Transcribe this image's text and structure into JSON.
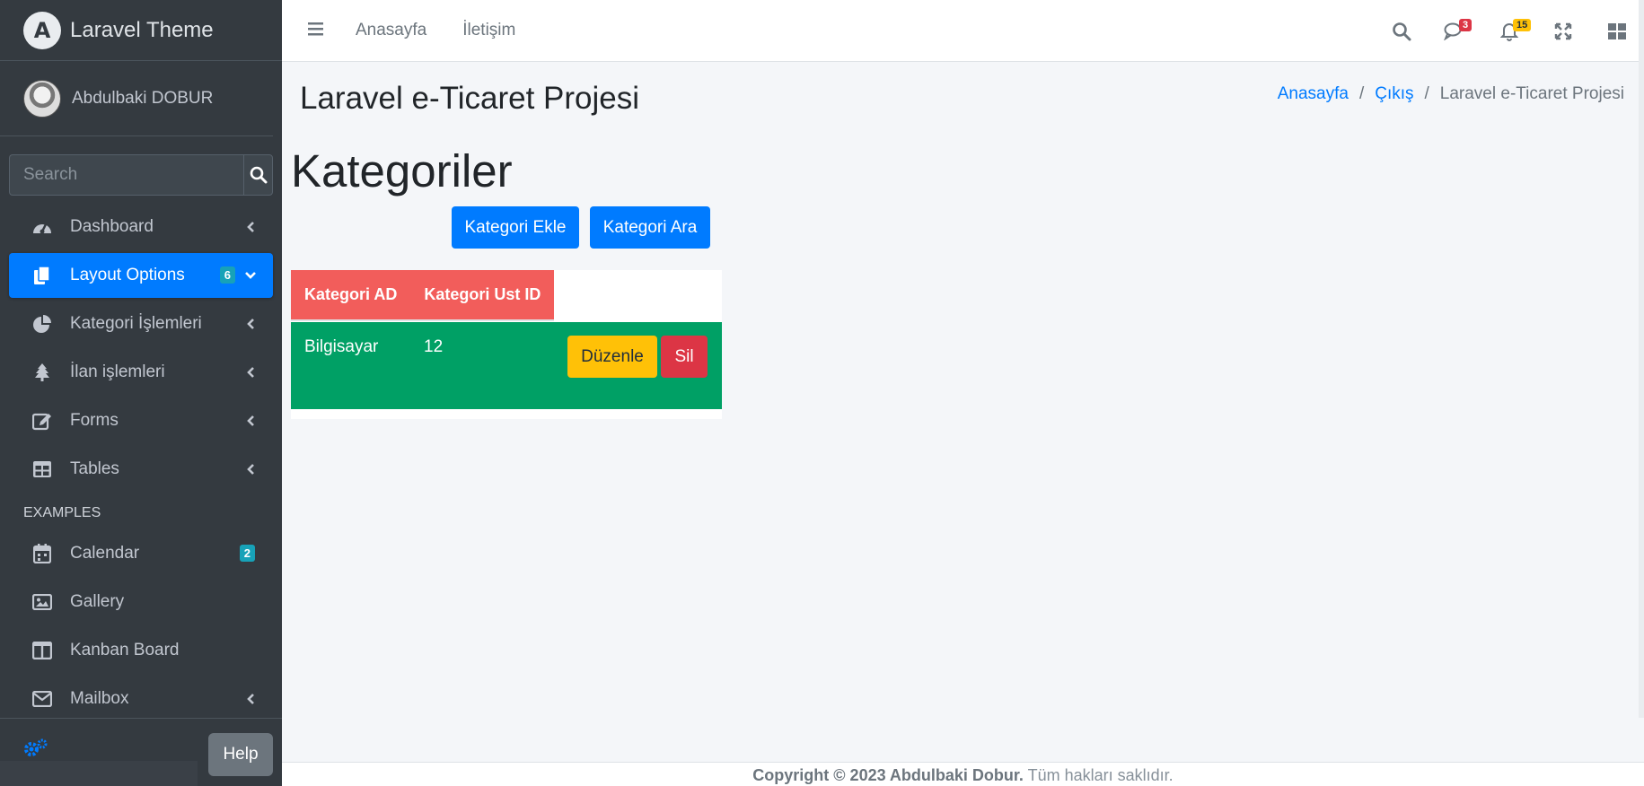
{
  "brand": {
    "logo_letter": "A",
    "name": "Laravel Theme"
  },
  "user": {
    "name": "Abdulbaki DOBUR"
  },
  "search": {
    "placeholder": "Search"
  },
  "sidebar": {
    "items": [
      {
        "label": "Dashboard",
        "icon": "tachometer-icon"
      },
      {
        "label": "Layout Options",
        "icon": "copy-icon",
        "badge": "6",
        "active": true
      },
      {
        "label": "Kategori İşlemleri",
        "icon": "chart-pie-icon"
      },
      {
        "label": "İlan işlemleri",
        "icon": "tree-icon"
      },
      {
        "label": "Forms",
        "icon": "edit-icon"
      },
      {
        "label": "Tables",
        "icon": "table-icon"
      }
    ],
    "header": "EXAMPLES",
    "examples": [
      {
        "label": "Calendar",
        "icon": "calendar-icon",
        "badge": "2"
      },
      {
        "label": "Gallery",
        "icon": "image-icon"
      },
      {
        "label": "Kanban Board",
        "icon": "columns-icon"
      },
      {
        "label": "Mailbox",
        "icon": "envelope-icon"
      }
    ],
    "help_label": "Help"
  },
  "topbar": {
    "links": [
      "Anasayfa",
      "İletişim"
    ],
    "messages_count": "3",
    "notifications_count": "15"
  },
  "page": {
    "title": "Laravel e-Ticaret Projesi",
    "breadcrumb": [
      "Anasayfa",
      "Çıkış",
      "Laravel e-Ticaret Projesi"
    ],
    "section_title": "Kategoriler",
    "buttons": {
      "add": "Kategori Ekle",
      "search": "Kategori Ara"
    },
    "table": {
      "headers": [
        "Kategori AD",
        "Kategori Ust ID"
      ],
      "rows": [
        {
          "name": "Bilgisayar",
          "parent_id": "12",
          "edit": "Düzenle",
          "delete": "Sil"
        }
      ]
    }
  },
  "footer": {
    "copyright": "Copyright © 2023 Abdulbaki Dobur.",
    "rights": "Tüm hakları saklıdır."
  },
  "colors": {
    "primary": "#007bff",
    "sidebar_bg": "#343a40",
    "table_header": "#f25d5b",
    "table_row": "#00a065",
    "warning": "#ffc107",
    "danger": "#dc3545"
  }
}
